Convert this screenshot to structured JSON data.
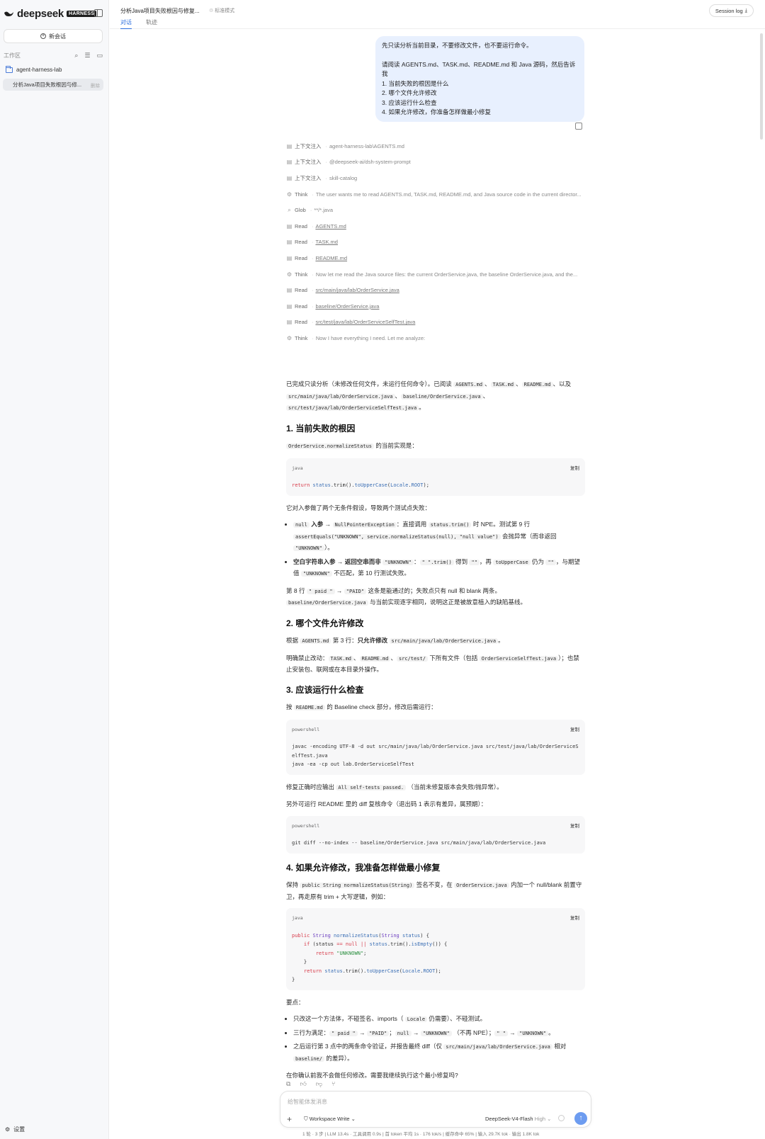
{
  "sidebar": {
    "brand": "deepseek",
    "badge": "HARNESS",
    "new_chat": "新会话",
    "workspace_label": "工作区",
    "folder": "agent-harness-lab",
    "session_title": "分析Java项目失败根因与修...",
    "session_delete": "删除",
    "settings": "设置"
  },
  "header": {
    "title": "分析Java项目失败根因与修复...",
    "mode": "标准模式",
    "tabs": [
      "对话",
      "轨迹"
    ],
    "session_log": "Session log"
  },
  "user_message": {
    "line1": "先只读分析当前目录，不要修改文件，也不要运行命令。",
    "line2": "请阅读 AGENTS.md、TASK.md、README.md 和 Java 源码，然后告诉我",
    "items": [
      "1. 当前失败的根因是什么",
      "2. 哪个文件允许修改",
      "3. 应该运行什么检查",
      "4. 如果允许修改，你准备怎样做最小修复"
    ]
  },
  "steps": [
    {
      "icon": "document-icon",
      "kind": "上下文注入",
      "detail": "agent-harness-lab\\AGENTS.md",
      "link": false
    },
    {
      "icon": "document-icon",
      "kind": "上下文注入",
      "detail": "@deepseek-ai/dsh-system-prompt",
      "link": false
    },
    {
      "icon": "document-icon",
      "kind": "上下文注入",
      "detail": "skill-catalog",
      "link": false
    },
    {
      "icon": "brain-icon",
      "kind": "Think",
      "detail": "The user wants me to read AGENTS.md, TASK.md, README.md, and Java source code in the current director...",
      "link": false
    },
    {
      "icon": "search-icon",
      "kind": "Glob",
      "detail": "**/*.java",
      "link": false
    },
    {
      "icon": "document-icon",
      "kind": "Read",
      "detail": "AGENTS.md",
      "link": true
    },
    {
      "icon": "document-icon",
      "kind": "Read",
      "detail": "TASK.md",
      "link": true
    },
    {
      "icon": "document-icon",
      "kind": "Read",
      "detail": "README.md",
      "link": true
    },
    {
      "icon": "brain-icon",
      "kind": "Think",
      "detail": "Now let me read the Java source files: the current OrderService.java, the baseline OrderService.java, and the...",
      "link": false
    },
    {
      "icon": "document-icon",
      "kind": "Read",
      "detail": "src/main/java/lab/OrderService.java",
      "link": true
    },
    {
      "icon": "document-icon",
      "kind": "Read",
      "detail": "baseline/OrderService.java",
      "link": true
    },
    {
      "icon": "document-icon",
      "kind": "Read",
      "detail": "src/test/java/lab/OrderServiceSelfTest.java",
      "link": true
    },
    {
      "icon": "brain-icon",
      "kind": "Think",
      "detail": "Now I have everything I need. Let me analyze:",
      "link": false
    }
  ],
  "answer": {
    "intro_a": "已完成只读分析（未修改任何文件，未运行任何命令）。已阅读",
    "intro_b": "、以及",
    "f_agents": "AGENTS.md",
    "f_task": "TASK.md",
    "f_readme": "README.md",
    "f_main": "src/main/java/lab/OrderService.java",
    "f_baseline": "baseline/OrderService.java",
    "f_test": "src/test/java/lab/OrderServiceSelfTest.java",
    "h1": "1. 当前失败的根因",
    "s1_p1_code": "OrderService.normalizeStatus",
    "s1_p1": "的当前实现是：",
    "code1_lang": "java",
    "copy": "复制",
    "s1_p2": "它对入参做了两个无条件假设，导致两个测试点失败：",
    "b1_code1": "null",
    "b1_bold": "入参",
    "b1_arrow": "→",
    "b1_code2": "NullPointerException",
    "b1_text1": "：直接调用",
    "b1_code3": "status.trim()",
    "b1_text2": "时 NPE。测试第 9 行",
    "b1_code4": "assertEquals(\"UNKNOWN\", service.normalizeStatus(null), \"null value\")",
    "b1_text3": "会抛异常（而非返回",
    "b1_code5": "\"UNKNOWN\"",
    "b1_text4": "）。",
    "b2_bold": "空白字符串入参 → 返回空串而非",
    "b2_code1": "\"UNKNOWN\"",
    "b2_text1": "：",
    "b2_code2": "\" \".trim()",
    "b2_text2": "得到",
    "b2_code3": "\"\"",
    "b2_text3": "，再",
    "b2_code4": "toUpperCase",
    "b2_text4": "仍为",
    "b2_code5": "\"\"",
    "b2_text5": "，与期望值",
    "b2_code6": "\"UNKNOWN\"",
    "b2_text6": "不匹配，第 10 行测试失败。",
    "s1_p3a": "第 8 行",
    "s1_p3_code1": "\" paid \"",
    "s1_p3_code2": "\"PAID\"",
    "s1_p3b": "这条是能通过的；失败点只有 null 和 blank 两条。",
    "s1_p3c": "与当前实现逐字相同，说明这正是被故意植入的缺陷基线。",
    "h2": "2. 哪个文件允许修改",
    "s2_p1a": "根据",
    "s2_p1b": "第 3 行：",
    "s2_p1_bold": "只允许修改",
    "s2_p2a": "明确禁止改动：",
    "s2_p2_code": "src/test/",
    "s2_p2b": "下所有文件（包括",
    "s2_p2_code2": "OrderServiceSelfTest.java",
    "s2_p2c": "）；也禁止安装包、联网或在本目录外操作。",
    "h3": "3. 应该运行什么检查",
    "s3_p1a": "按",
    "s3_p1b": "的 Baseline check 部分，修改后需运行：",
    "code2_lang": "powershell",
    "s3_p2a": "修复正确时应输出",
    "s3_p2_code": "All self-tests passed.",
    "s3_p2b": "（当前未修复版本会失败/抛异常）。",
    "s3_p3": "另外可运行 README 里的 diff 复核命令（退出码 1 表示有差异，属预期）：",
    "code3_lang": "powershell",
    "h4": "4. 如果允许修改，我准备怎样做最小修复",
    "s4_p1a": "保持",
    "s4_p1_code": "public String normalizeStatus(String)",
    "s4_p1b": "签名不变，在",
    "s4_p1_code2": "OrderService.java",
    "s4_p1c": "内加一个 null/blank 前置守卫，再走原有 trim + 大写逻辑，例如：",
    "code4_lang": "java",
    "s4_p2": "要点：",
    "k1a": "只改这一个方法体，不碰签名、imports（",
    "k1_code": "Locale",
    "k1b": "仍需要）、不碰测试。",
    "k2a": "三行为满足：",
    "k2_c1": "\" paid \"",
    "k2_c2": "\"PAID\"",
    "k2_c3": "null",
    "k2_c4": "\"UNKNOWN\"",
    "k2_mid": "（不再 NPE）；",
    "k2_c5": "\" \"",
    "k2_c6": "\"UNKNOWN\"",
    "k2_end": "。",
    "k3a": "之后运行第 3 点中的两条命令验证，并报告最终 diff（仅",
    "k3_code": "src/main/java/lab/OrderService.java",
    "k3b": "相对",
    "k3_code2": "baseline/",
    "k3c": "的差异）。",
    "closing": "在你确认前我不会做任何修改。需要我继续执行这个最小修复吗?"
  },
  "code_lines": {
    "c1": "return status.trim().toUpperCase(Locale.ROOT);",
    "c2a": "javac -encoding UTF-8 -d out src/main/java/lab/OrderService.java src/test/java/lab/OrderServiceSelfTest.java",
    "c2b": "java -ea -cp out lab.OrderServiceSelfTest",
    "c3": "git diff --no-index -- baseline/OrderService.java src/main/java/lab/OrderService.java",
    "c4_1": "public String normalizeStatus(String status) {",
    "c4_2": "if (status == null || status.trim().isEmpty()) {",
    "c4_3": "return \"UNKNOWN\";",
    "c4_4": "}",
    "c4_5": "return status.trim().toUpperCase(Locale.ROOT);",
    "c4_6": "}"
  },
  "composer": {
    "placeholder": "给智能体发消息",
    "workspace_write": "Workspace Write",
    "model": "DeepSeek-V4-Flash",
    "effort": "High"
  },
  "statusbar": "1 轮 · 3 步  |  LLM 13.4s · 工具调用 0.9s  |  首 token 平均 1s · 176 tok/s  |  缓存命中 65%  |  输入 29.7K tok · 输出 1.8K tok",
  "colors": {
    "accent": "#2a6dde",
    "user_bubble": "#e8f0fe",
    "send": "#6d9cf0"
  }
}
